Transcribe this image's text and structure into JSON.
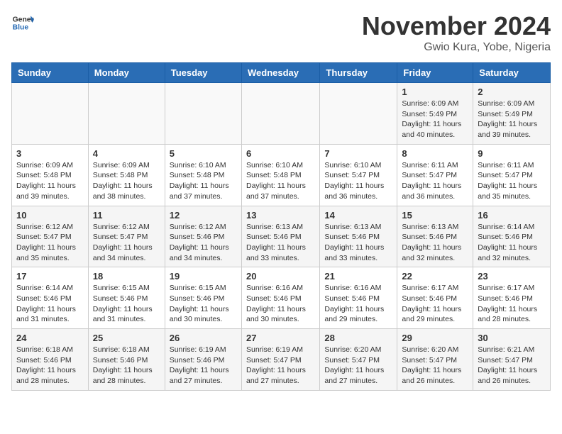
{
  "header": {
    "logo_general": "General",
    "logo_blue": "Blue",
    "title": "November 2024",
    "location": "Gwio Kura, Yobe, Nigeria"
  },
  "weekdays": [
    "Sunday",
    "Monday",
    "Tuesday",
    "Wednesday",
    "Thursday",
    "Friday",
    "Saturday"
  ],
  "weeks": [
    [
      {
        "day": "",
        "info": ""
      },
      {
        "day": "",
        "info": ""
      },
      {
        "day": "",
        "info": ""
      },
      {
        "day": "",
        "info": ""
      },
      {
        "day": "",
        "info": ""
      },
      {
        "day": "1",
        "info": "Sunrise: 6:09 AM\nSunset: 5:49 PM\nDaylight: 11 hours and 40 minutes."
      },
      {
        "day": "2",
        "info": "Sunrise: 6:09 AM\nSunset: 5:49 PM\nDaylight: 11 hours and 39 minutes."
      }
    ],
    [
      {
        "day": "3",
        "info": "Sunrise: 6:09 AM\nSunset: 5:48 PM\nDaylight: 11 hours and 39 minutes."
      },
      {
        "day": "4",
        "info": "Sunrise: 6:09 AM\nSunset: 5:48 PM\nDaylight: 11 hours and 38 minutes."
      },
      {
        "day": "5",
        "info": "Sunrise: 6:10 AM\nSunset: 5:48 PM\nDaylight: 11 hours and 37 minutes."
      },
      {
        "day": "6",
        "info": "Sunrise: 6:10 AM\nSunset: 5:48 PM\nDaylight: 11 hours and 37 minutes."
      },
      {
        "day": "7",
        "info": "Sunrise: 6:10 AM\nSunset: 5:47 PM\nDaylight: 11 hours and 36 minutes."
      },
      {
        "day": "8",
        "info": "Sunrise: 6:11 AM\nSunset: 5:47 PM\nDaylight: 11 hours and 36 minutes."
      },
      {
        "day": "9",
        "info": "Sunrise: 6:11 AM\nSunset: 5:47 PM\nDaylight: 11 hours and 35 minutes."
      }
    ],
    [
      {
        "day": "10",
        "info": "Sunrise: 6:12 AM\nSunset: 5:47 PM\nDaylight: 11 hours and 35 minutes."
      },
      {
        "day": "11",
        "info": "Sunrise: 6:12 AM\nSunset: 5:47 PM\nDaylight: 11 hours and 34 minutes."
      },
      {
        "day": "12",
        "info": "Sunrise: 6:12 AM\nSunset: 5:46 PM\nDaylight: 11 hours and 34 minutes."
      },
      {
        "day": "13",
        "info": "Sunrise: 6:13 AM\nSunset: 5:46 PM\nDaylight: 11 hours and 33 minutes."
      },
      {
        "day": "14",
        "info": "Sunrise: 6:13 AM\nSunset: 5:46 PM\nDaylight: 11 hours and 33 minutes."
      },
      {
        "day": "15",
        "info": "Sunrise: 6:13 AM\nSunset: 5:46 PM\nDaylight: 11 hours and 32 minutes."
      },
      {
        "day": "16",
        "info": "Sunrise: 6:14 AM\nSunset: 5:46 PM\nDaylight: 11 hours and 32 minutes."
      }
    ],
    [
      {
        "day": "17",
        "info": "Sunrise: 6:14 AM\nSunset: 5:46 PM\nDaylight: 11 hours and 31 minutes."
      },
      {
        "day": "18",
        "info": "Sunrise: 6:15 AM\nSunset: 5:46 PM\nDaylight: 11 hours and 31 minutes."
      },
      {
        "day": "19",
        "info": "Sunrise: 6:15 AM\nSunset: 5:46 PM\nDaylight: 11 hours and 30 minutes."
      },
      {
        "day": "20",
        "info": "Sunrise: 6:16 AM\nSunset: 5:46 PM\nDaylight: 11 hours and 30 minutes."
      },
      {
        "day": "21",
        "info": "Sunrise: 6:16 AM\nSunset: 5:46 PM\nDaylight: 11 hours and 29 minutes."
      },
      {
        "day": "22",
        "info": "Sunrise: 6:17 AM\nSunset: 5:46 PM\nDaylight: 11 hours and 29 minutes."
      },
      {
        "day": "23",
        "info": "Sunrise: 6:17 AM\nSunset: 5:46 PM\nDaylight: 11 hours and 28 minutes."
      }
    ],
    [
      {
        "day": "24",
        "info": "Sunrise: 6:18 AM\nSunset: 5:46 PM\nDaylight: 11 hours and 28 minutes."
      },
      {
        "day": "25",
        "info": "Sunrise: 6:18 AM\nSunset: 5:46 PM\nDaylight: 11 hours and 28 minutes."
      },
      {
        "day": "26",
        "info": "Sunrise: 6:19 AM\nSunset: 5:46 PM\nDaylight: 11 hours and 27 minutes."
      },
      {
        "day": "27",
        "info": "Sunrise: 6:19 AM\nSunset: 5:47 PM\nDaylight: 11 hours and 27 minutes."
      },
      {
        "day": "28",
        "info": "Sunrise: 6:20 AM\nSunset: 5:47 PM\nDaylight: 11 hours and 27 minutes."
      },
      {
        "day": "29",
        "info": "Sunrise: 6:20 AM\nSunset: 5:47 PM\nDaylight: 11 hours and 26 minutes."
      },
      {
        "day": "30",
        "info": "Sunrise: 6:21 AM\nSunset: 5:47 PM\nDaylight: 11 hours and 26 minutes."
      }
    ]
  ]
}
